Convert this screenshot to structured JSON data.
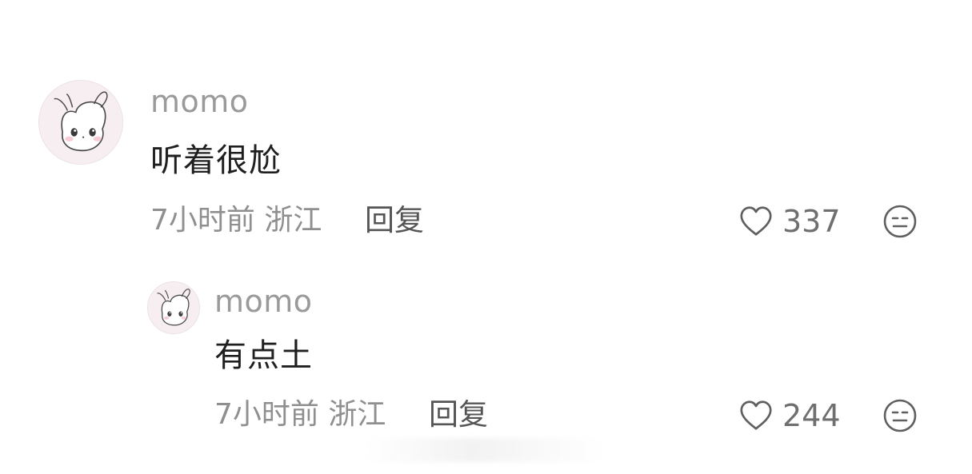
{
  "comments": [
    {
      "username": "momo",
      "text": "听着很尬",
      "meta": "7小时前 浙江",
      "reply_label": "回复",
      "likes": "337",
      "avatar_icon": "cartoon-bunny-avatar"
    },
    {
      "username": "momo",
      "text": "有点土",
      "meta": "7小时前 浙江",
      "reply_label": "回复",
      "likes": "244",
      "avatar_icon": "cartoon-bunny-avatar"
    }
  ],
  "icons": {
    "like": "heart-outline-icon",
    "dislike": "neutral-face-icon"
  },
  "colors": {
    "username": "#9a9a9a",
    "text": "#1f1f1f",
    "meta": "#8f8f8f",
    "reply": "#555555",
    "avatar_bg": "#f6eef1"
  }
}
